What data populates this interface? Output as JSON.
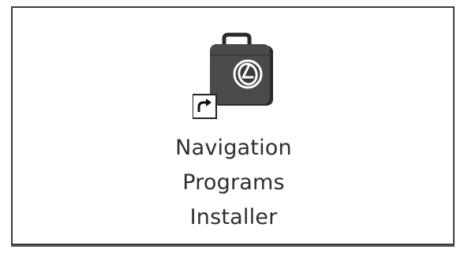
{
  "desktop": {
    "shortcut": {
      "icon": "briefcase-logo-icon",
      "overlay_icon": "shortcut-arrow-icon",
      "label_lines": [
        "Navigation",
        "Programs",
        "Installer"
      ]
    }
  },
  "colors": {
    "border": "#3c3c3c",
    "icon_body": "#4a4a4a",
    "icon_shadow": "#2a2a2a",
    "label_text": "#2e2e2e"
  }
}
